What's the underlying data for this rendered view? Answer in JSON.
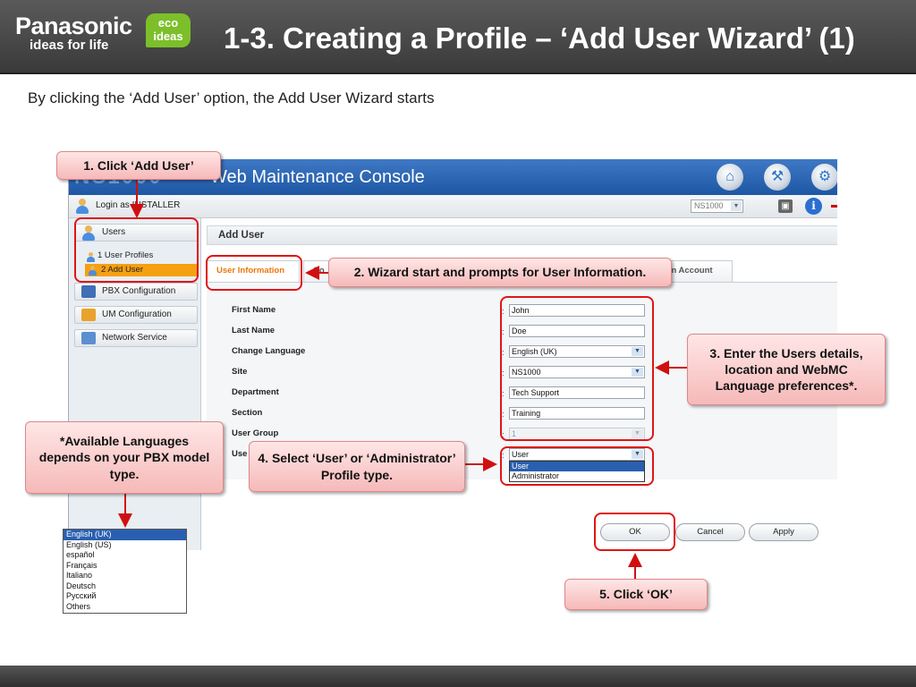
{
  "slide": {
    "brand": "Panasonic",
    "brand_tagline": "ideas for life",
    "eco_badge_top": "eco",
    "eco_badge_bottom": "ideas",
    "title": "1-3. Creating a Profile – ‘Add User Wizard’ (1)",
    "intro": "By clicking the ‘Add User’ option, the Add User Wizard starts"
  },
  "console": {
    "logo": "NS1000",
    "title": "Web Maintenance Console",
    "login_text": "Login as INSTALLER",
    "system_select": "NS1000",
    "icons": [
      "home-icon",
      "tools-icon",
      "settings-icon",
      "save-icon",
      "info-icon"
    ],
    "nav": {
      "users": "Users",
      "user_profiles": "1 User Profiles",
      "add_user": "2 Add User",
      "pbx_configuration": "PBX Configuration",
      "um_configuration": "UM Configuration",
      "network_service": "Network Service"
    },
    "page_title": "Add User",
    "tabs": {
      "user_information": "User Information",
      "partial": "Co",
      "login_account": "gin Account"
    },
    "form": {
      "first_name_label": "First Name",
      "first_name_value": "John",
      "last_name_label": "Last Name",
      "last_name_value": "Doe",
      "change_language_label": "Change Language",
      "change_language_value": "English (UK)",
      "site_label": "Site",
      "site_value": "NS1000",
      "department_label": "Department",
      "department_value": "Tech Support",
      "section_label": "Section",
      "section_value": "Training",
      "user_group_label": "User Group",
      "user_group_value": "1",
      "user_type_label": "Use",
      "user_type_value": "User",
      "user_type_options": [
        "User",
        "Administrator"
      ]
    },
    "buttons": {
      "ok": "OK",
      "cancel": "Cancel",
      "apply": "Apply"
    }
  },
  "language_options": [
    "English (UK)",
    "English (US)",
    "español",
    "Français",
    "Italiano",
    "Deutsch",
    "Русский",
    "Others"
  ],
  "callouts": {
    "click_add_user": "1. Click ‘Add User’",
    "wizard_start": "2. Wizard start and prompts for User Information.",
    "enter_details": "3. Enter the Users details, location and WebMC Language preferences*.",
    "select_profile": "4. Select ‘User’ or ‘Administrator’ Profile type.",
    "click_ok": "5. Click ‘OK’",
    "languages_note": "*Available Languages depends on your PBX model type."
  },
  "colors": {
    "header_blue": "#1d57a4",
    "accent_orange": "#f5a012",
    "highlight_red": "#e01515",
    "callout_pink": "#f6b9b9"
  }
}
